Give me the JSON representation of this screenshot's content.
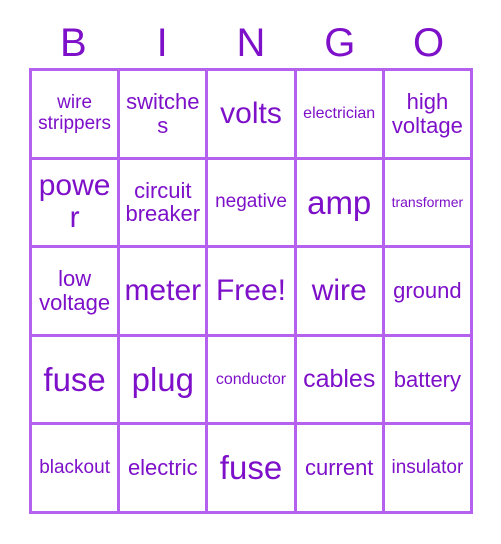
{
  "card": {
    "title_letters": [
      "B",
      "I",
      "N",
      "G",
      "O"
    ],
    "accent_color": "#7d10c8",
    "border_color": "#b461f0",
    "background_color": "#ffffff",
    "columns": 5,
    "rows": 5,
    "free_space": "Free!"
  },
  "cells": [
    {
      "text": "wire strippers",
      "size": "fs-md",
      "row": 1,
      "col": "B"
    },
    {
      "text": "switches",
      "size": "fs-lg",
      "row": 1,
      "col": "I"
    },
    {
      "text": "volts",
      "size": "fs-xxl",
      "row": 1,
      "col": "N"
    },
    {
      "text": "electrician",
      "size": "fs-sm",
      "row": 1,
      "col": "G"
    },
    {
      "text": "high voltage",
      "size": "fs-lg",
      "row": 1,
      "col": "O"
    },
    {
      "text": "power",
      "size": "fs-xxl",
      "row": 2,
      "col": "B"
    },
    {
      "text": "circuit breaker",
      "size": "fs-lg",
      "row": 2,
      "col": "I"
    },
    {
      "text": "negative",
      "size": "fs-md",
      "row": 2,
      "col": "N"
    },
    {
      "text": "amp",
      "size": "fs-huge",
      "row": 2,
      "col": "G"
    },
    {
      "text": "transformer",
      "size": "fs-xs",
      "row": 2,
      "col": "O"
    },
    {
      "text": "low voltage",
      "size": "fs-lg",
      "row": 3,
      "col": "B"
    },
    {
      "text": "meter",
      "size": "fs-xxl",
      "row": 3,
      "col": "I"
    },
    {
      "text": "Free!",
      "size": "fs-xxl",
      "row": 3,
      "col": "N"
    },
    {
      "text": "wire",
      "size": "fs-xxl",
      "row": 3,
      "col": "G"
    },
    {
      "text": "ground",
      "size": "fs-lg",
      "row": 3,
      "col": "O"
    },
    {
      "text": "fuse",
      "size": "fs-huge",
      "row": 4,
      "col": "B"
    },
    {
      "text": "plug",
      "size": "fs-huge",
      "row": 4,
      "col": "I"
    },
    {
      "text": "conductor",
      "size": "fs-sm",
      "row": 4,
      "col": "N"
    },
    {
      "text": "cables",
      "size": "fs-xl",
      "row": 4,
      "col": "G"
    },
    {
      "text": "battery",
      "size": "fs-lg",
      "row": 4,
      "col": "O"
    },
    {
      "text": "blackout",
      "size": "fs-md",
      "row": 5,
      "col": "B"
    },
    {
      "text": "electric",
      "size": "fs-lg",
      "row": 5,
      "col": "I"
    },
    {
      "text": "fuse",
      "size": "fs-huge",
      "row": 5,
      "col": "N"
    },
    {
      "text": "current",
      "size": "fs-lg",
      "row": 5,
      "col": "G"
    },
    {
      "text": "insulator",
      "size": "fs-md",
      "row": 5,
      "col": "O"
    }
  ]
}
